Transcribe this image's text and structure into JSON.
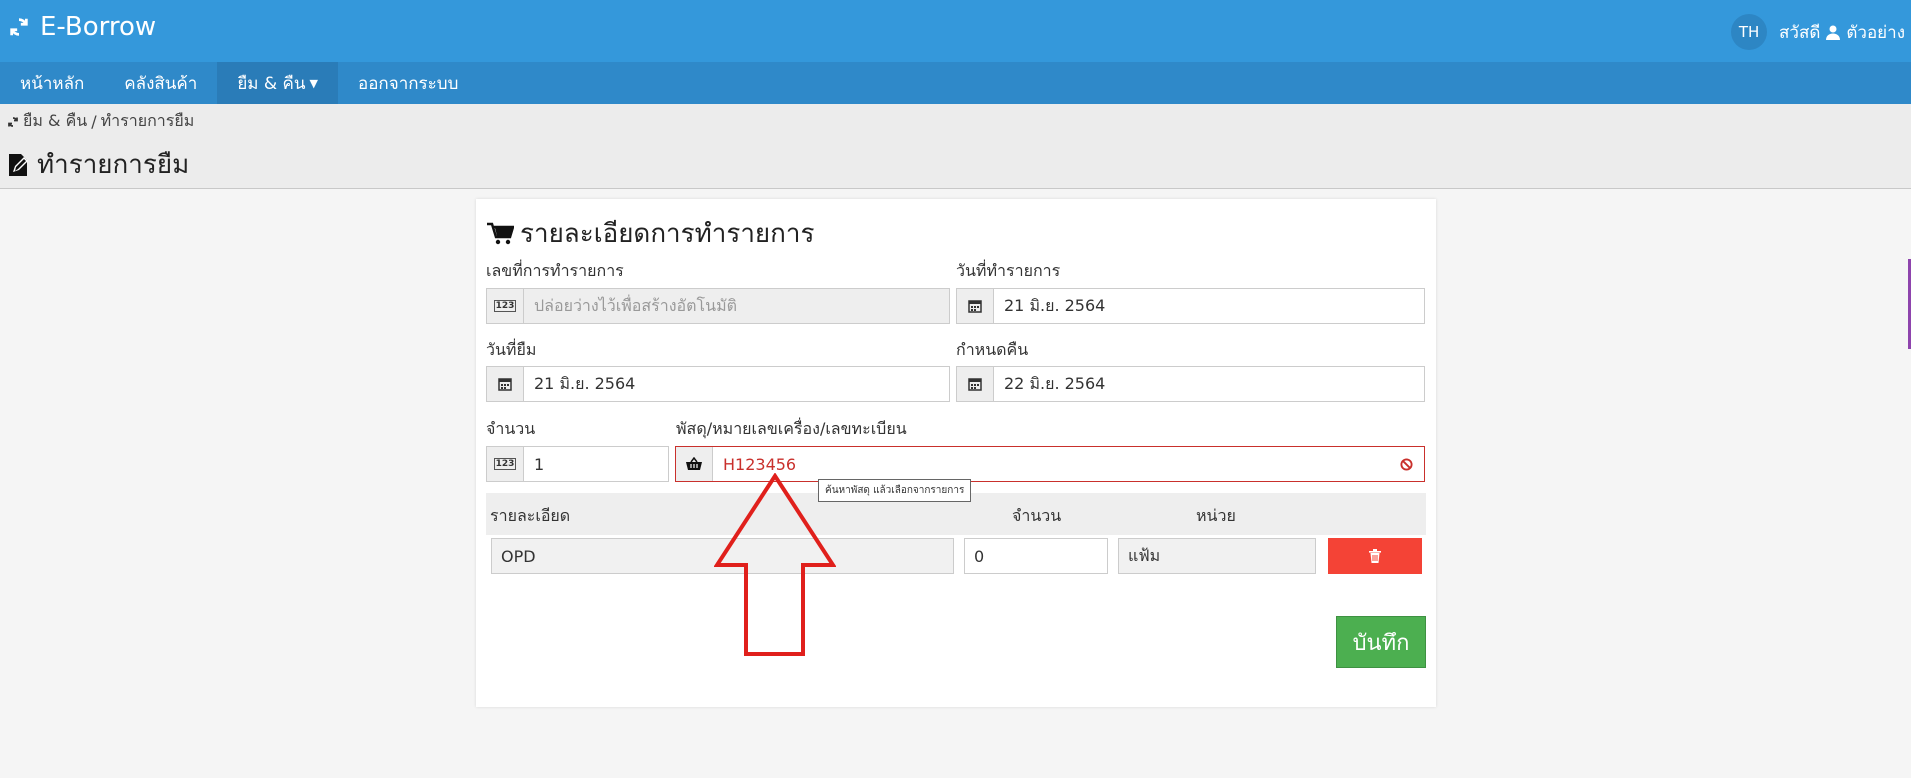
{
  "app": {
    "brand": "E-Borrow",
    "lang": "TH",
    "greeting": "สวัสดี",
    "username": "ตัวอย่าง"
  },
  "nav": {
    "items": [
      "หน้าหลัก",
      "คลังสินค้า",
      "ยืม & คืน",
      "ออกจากระบบ"
    ]
  },
  "breadcrumb": {
    "section": "ยืม & คืน",
    "separator": "/",
    "current": "ทำรายการยืม"
  },
  "page_title": "ทำรายการยืม",
  "form": {
    "title": "รายละเอียดการทำรายการ",
    "txn_no_label": "เลขที่การทำรายการ",
    "txn_no_placeholder": "ปล่อยว่างไว้เพื่อสร้างอัตโนมัติ",
    "txn_date_label": "วันที่ทำรายการ",
    "txn_date_value": "21 มิ.ย. 2564",
    "borrow_date_label": "วันที่ยืม",
    "borrow_date_value": "21 มิ.ย. 2564",
    "due_date_label": "กำหนดคืน",
    "due_date_value": "22 มิ.ย. 2564",
    "qty_label": "จำนวน",
    "qty_value": "1",
    "item_label": "พัสดุ/หมายเลขเครื่อง/เลขทะเบียน",
    "item_value": "H123456",
    "item_tooltip": "ค้นหาพัสดุ แล้วเลือกจากรายการ",
    "table": {
      "headers": [
        "รายละเอียด",
        "จำนวน",
        "หน่วย"
      ],
      "row": {
        "detail": "OPD",
        "qty": "0",
        "unit": "แฟ้ม"
      }
    },
    "save_label": "บันทึก"
  },
  "colors": {
    "topbar": "#3498db",
    "navbar": "#2f89c9",
    "error": "#c9302c",
    "danger": "#f44336",
    "success": "#4caf50",
    "annotation_arrow": "#e0201c"
  },
  "icons": [
    "refresh-icon",
    "user-icon",
    "edit-document-icon",
    "cart-icon",
    "number-icon",
    "calendar-icon",
    "basket-icon",
    "ban-icon",
    "trash-icon"
  ]
}
